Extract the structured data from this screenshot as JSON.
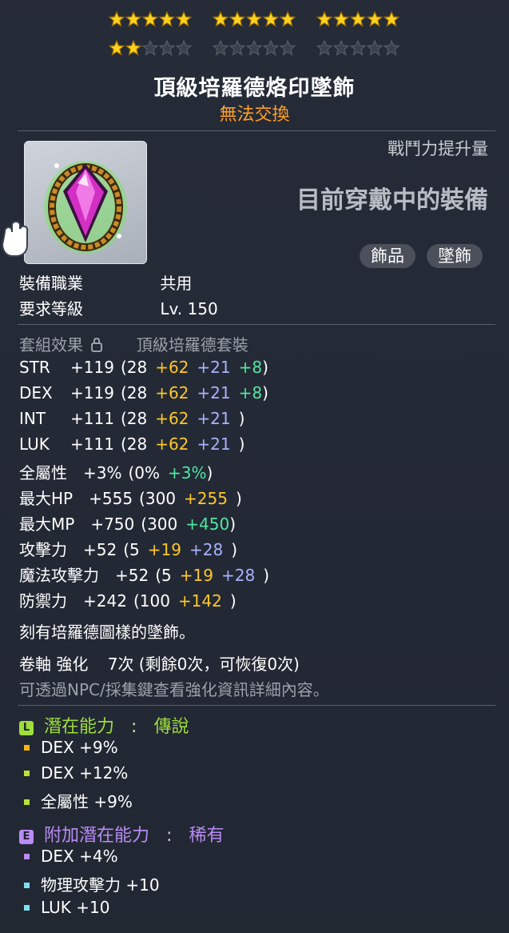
{
  "stars": {
    "filled": 17,
    "total": 30
  },
  "item": {
    "name": "頂級培羅德烙印墜飾",
    "trade_status": "無法交換",
    "combat_power_label": "戰鬥力提升量",
    "equipped_label": "目前穿戴中的裝備",
    "tags": [
      "飾品",
      "墜飾"
    ]
  },
  "requirements": {
    "job_label": "裝備職業",
    "job_value": "共用",
    "level_label": "要求等級",
    "level_value": "Lv. 150"
  },
  "set_effect": {
    "label": "套組效果",
    "value": "頂級培羅德套裝"
  },
  "stats": [
    {
      "name": "STR",
      "total": "+119",
      "base": "(28",
      "flame": "+62",
      "enhance": "+21",
      "extra": "+8",
      "close": ")"
    },
    {
      "name": "DEX",
      "total": "+119",
      "base": "(28",
      "flame": "+62",
      "enhance": "+21",
      "extra": "+8",
      "close": ")"
    },
    {
      "name": "INT",
      "total": "+111",
      "base": "(28",
      "flame": "+62",
      "enhance": "+21",
      "close": ")"
    },
    {
      "name": "LUK",
      "total": "+111",
      "base": "(28",
      "flame": "+62",
      "enhance": "+21",
      "close": ")"
    },
    {
      "name": "全屬性",
      "total": "+3%",
      "base": "(0%",
      "extra": "+3%",
      "close": ")"
    },
    {
      "name": "最大HP",
      "total": "+555",
      "base": "(300",
      "flame": "+255",
      "close": ")"
    },
    {
      "name": "最大MP",
      "total": "+750",
      "base": "(300",
      "extra": "+450",
      "close": ")"
    },
    {
      "name": "攻擊力",
      "total": "+52",
      "base": "(5",
      "flame": "+19",
      "enhance": "+28",
      "close": ")"
    },
    {
      "name": "魔法攻擊力",
      "total": "+52",
      "base": "(5",
      "flame": "+19",
      "enhance": "+28",
      "close": ")"
    },
    {
      "name": "防禦力",
      "total": "+242",
      "base": "(100",
      "flame": "+142",
      "close": ")"
    }
  ],
  "description": "刻有培羅德圖樣的墜飾。",
  "scroll": {
    "label": "卷軸 強化",
    "value": "7次 (剩餘0次，可恢復0次)"
  },
  "hint": "可透過NPC/採集鍵查看強化資訊詳細內容。",
  "potential": {
    "badge": "L",
    "label": "潛在能力",
    "sep": ":",
    "tier": "傳說",
    "lines": [
      "DEX +9%",
      "DEX +12%",
      "全屬性 +9%"
    ]
  },
  "additional_potential": {
    "badge": "E",
    "label": "附加潛在能力",
    "sep": ":",
    "tier": "稀有",
    "lines": [
      "DEX +4%",
      "物理攻擊力 +10",
      "LUK +10"
    ]
  },
  "colors": {
    "gold": "#ffc72a",
    "blue": "#a8b2ff",
    "green": "#52e5a4",
    "orange": "#ff9f27",
    "legendary": "#9ede3e",
    "epic_purple": "#b98cf5"
  }
}
